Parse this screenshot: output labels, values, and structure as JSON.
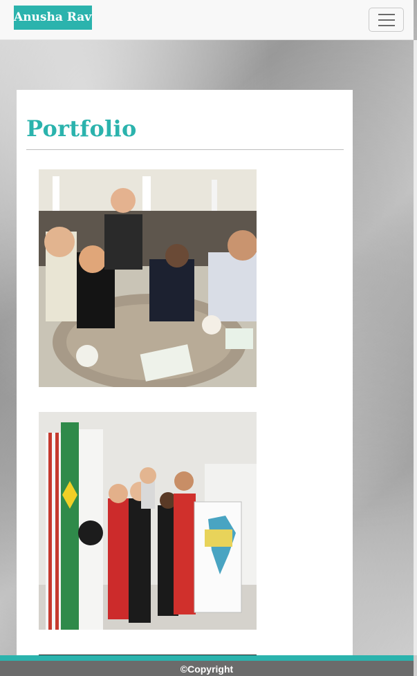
{
  "navbar": {
    "brand": "Anusha Ravva",
    "toggle_icon": "hamburger-menu-icon"
  },
  "main": {
    "title": "Portfolio",
    "photos": [
      {
        "description_icon": "photo-dinner-table"
      },
      {
        "description_icon": "photo-group-flags"
      },
      {
        "description_icon": "photo-partial"
      }
    ]
  },
  "footer": {
    "text": "©Copyright"
  },
  "colors": {
    "accent": "#2bb3ad",
    "navbar_bg": "#f8f8f8",
    "footer_bg": "#6b6b6b"
  }
}
